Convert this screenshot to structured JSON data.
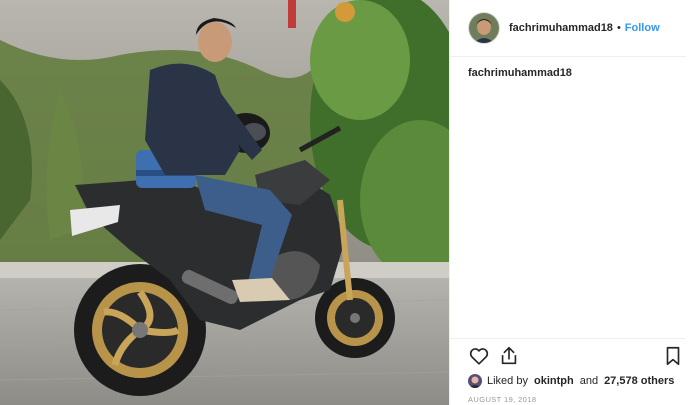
{
  "post": {
    "author": {
      "username": "fachrimuhammad18",
      "follow_label": "Follow",
      "separator": "•"
    },
    "caption": "fachrimuhammad18",
    "likes": {
      "prefix": "Liked by",
      "liker": "okintph",
      "joiner": "and",
      "count_text": "27,578 others"
    },
    "date": "AUGUST 19, 2018"
  },
  "colors": {
    "link": "#3897f0",
    "text": "#262626",
    "muted": "#999999",
    "divider": "#efefef"
  },
  "icons": [
    "heart-icon",
    "share-icon",
    "bookmark-icon"
  ]
}
